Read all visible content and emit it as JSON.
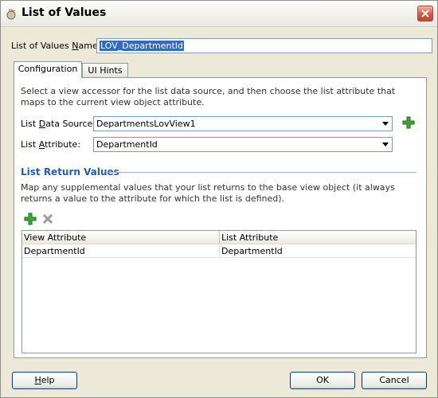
{
  "window": {
    "title": "List of Values",
    "icon": "lov-icon"
  },
  "name_field": {
    "label_pre": "List of Values ",
    "label_u": "N",
    "label_post": "ame:",
    "value": "LOV_DepartmentId"
  },
  "tabs": [
    {
      "label": "Configuration",
      "active": true
    },
    {
      "label": "UI Hints",
      "active": false
    }
  ],
  "configuration": {
    "description": "Select a view accessor for the list data source, and then choose the list attribute that maps to the current view object attribute.",
    "data_source": {
      "label_pre": "List ",
      "label_u": "D",
      "label_post": "ata Source:",
      "value": "DepartmentsLovView1"
    },
    "list_attribute": {
      "label_pre": "List ",
      "label_u": "A",
      "label_post": "ttribute:",
      "value": "DepartmentId"
    },
    "return_values": {
      "title": "List Return Values",
      "description": "Map any supplemental values that your list returns to the base view object (it always returns a value to the attribute for which the list is defined).",
      "columns": [
        "View Attribute",
        "List Attribute"
      ],
      "rows": [
        [
          "DepartmentId",
          "DepartmentId"
        ]
      ]
    }
  },
  "buttons": {
    "help_u": "H",
    "help_post": "elp",
    "ok": "OK",
    "cancel": "Cancel"
  },
  "colors": {
    "accent": "#2a5ca8",
    "add": "#2e9c2e"
  }
}
